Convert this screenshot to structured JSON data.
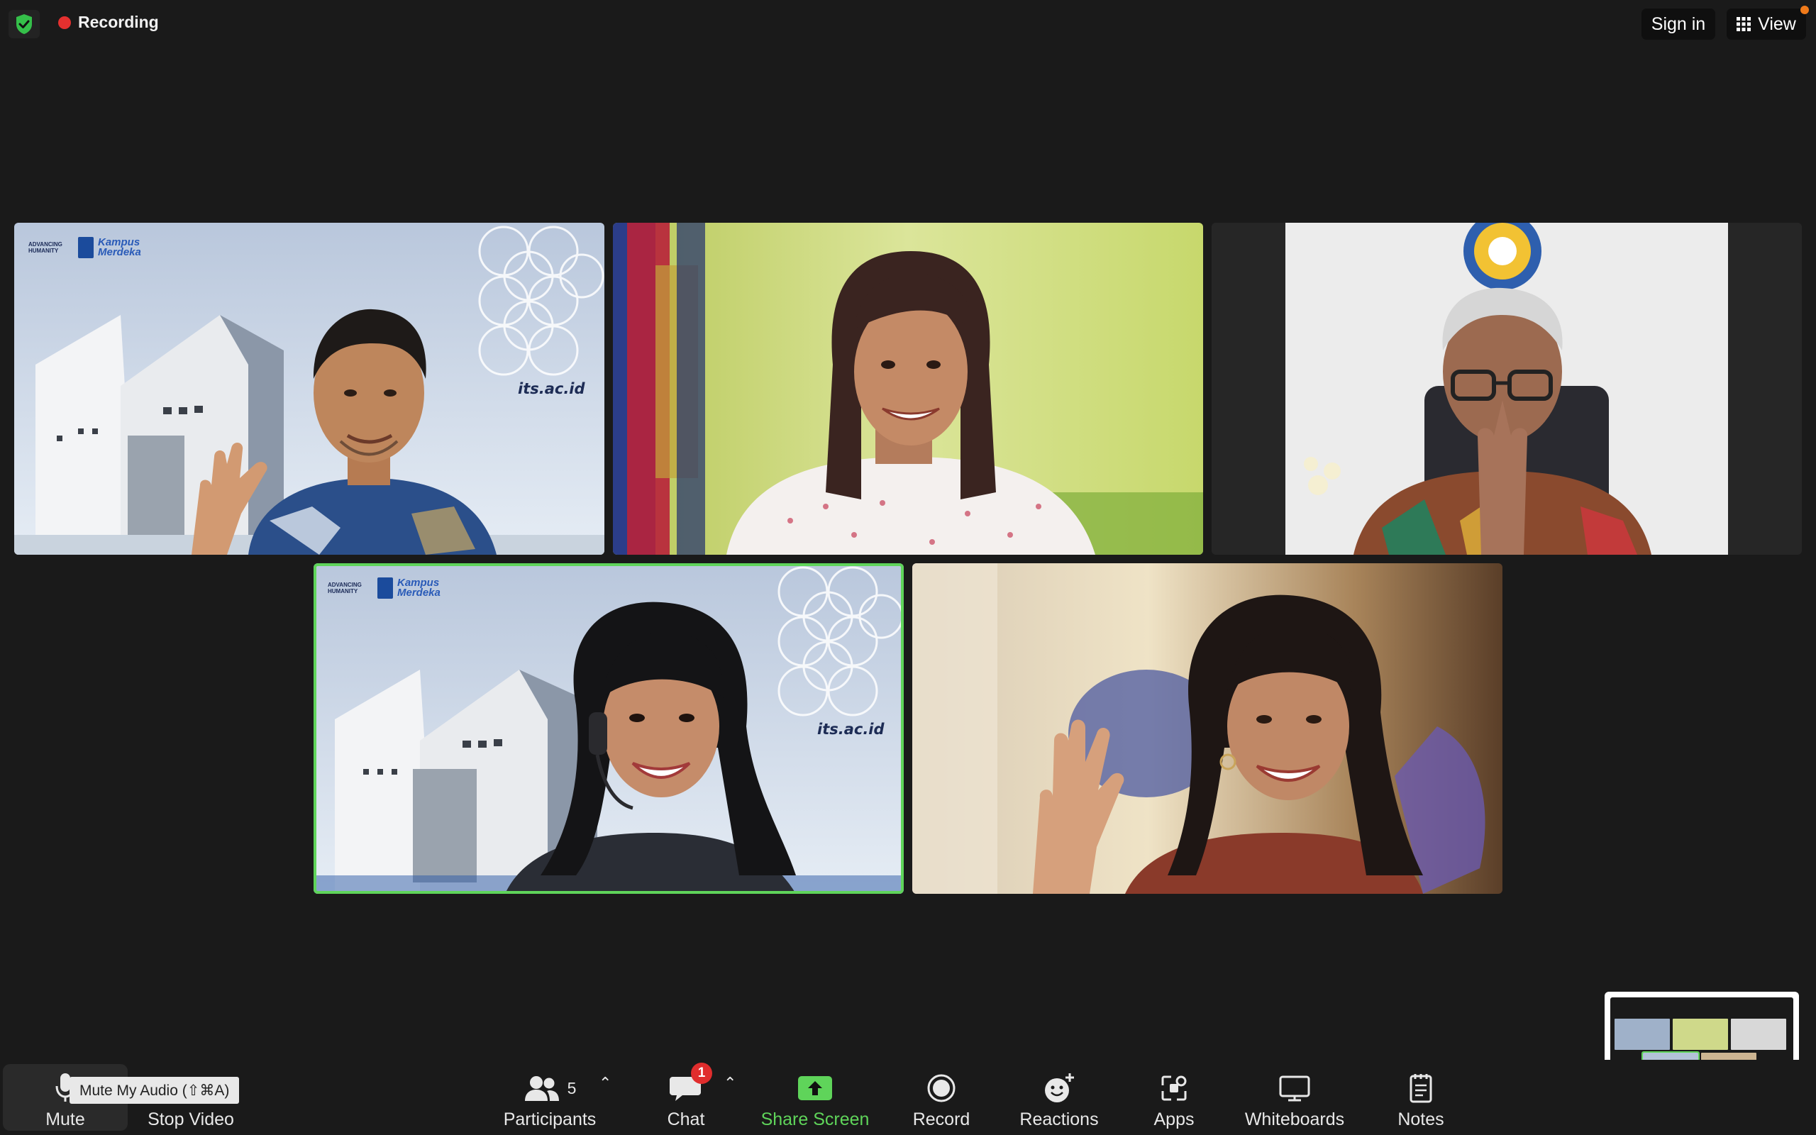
{
  "top_bar": {
    "recording_label": "Recording",
    "sign_in_label": "Sign in",
    "view_label": "View"
  },
  "tiles": {
    "its_label": "its.ac.id",
    "adv_text": "ADVANCING HUMANITY",
    "kampus_text": "Kampus Merdeka"
  },
  "toolbar": {
    "mute_label": "Mute",
    "mute_tooltip": "Mute My Audio (⇧⌘A)",
    "stop_video_label": "Stop Video",
    "participants_label": "Participants",
    "participants_count": "5",
    "chat_label": "Chat",
    "chat_badge": "1",
    "share_screen_label": "Share Screen",
    "record_label": "Record",
    "reactions_label": "Reactions",
    "apps_label": "Apps",
    "whiteboards_label": "Whiteboards",
    "notes_label": "Notes"
  },
  "colors": {
    "background": "#1a1a1a",
    "active_speaker_border": "#5fd45a",
    "recording_dot": "#e5302f",
    "share_screen_green": "#5fd45a",
    "chat_badge": "#e02d2d"
  },
  "icons": {
    "security": "shield-check-icon",
    "view": "grid-icon",
    "mute": "microphone-icon",
    "participants": "people-icon",
    "chat": "speech-bubble-icon",
    "share_screen": "up-arrow-screen-icon",
    "record": "record-circle-icon",
    "reactions": "smiley-plus-icon",
    "apps": "apps-icon",
    "whiteboards": "whiteboard-icon",
    "notes": "notepad-icon"
  }
}
